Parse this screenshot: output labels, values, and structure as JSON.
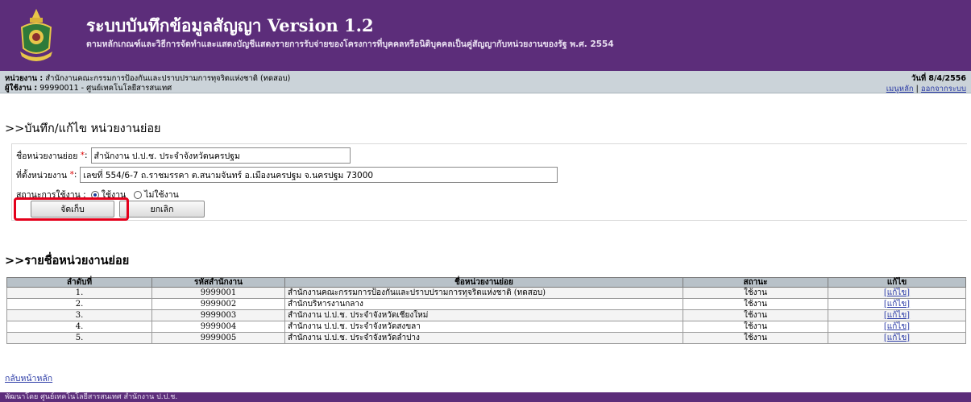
{
  "header": {
    "title": "ระบบบันทึกข้อมูลสัญญา Version 1.2",
    "subtitle": "ตามหลักเกณฑ์และวิธีการจัดทำและแสดงบัญชีแสดงรายการรับจ่ายของโครงการที่บุคคลหรือนิติบุคคลเป็นคู่สัญญากับหน่วยงานของรัฐ พ.ศ. 2554",
    "logo_icon": "emblem-icon",
    "bg_color": "#5c2d7a"
  },
  "info": {
    "agency_label": "หน่วยงาน :",
    "agency_value": "สำนักงานคณะกรรมการป้องกันและปราบปรามการทุจริตแห่งชาติ (ทดสอบ)",
    "user_label": "ผู้ใช้งาน :",
    "user_value": "99990011 - ศูนย์เทคโนโลยีสารสนเทศ",
    "date": "วันที่ 8/4/2556",
    "home_link": "เมนูหลัก",
    "separator": "|",
    "logout_link": "ออกจากระบบ"
  },
  "form": {
    "section_title": ">>บันทึก/แก้ไข หน่วยงานย่อย",
    "name_label": "ชื่อหน่วยงานย่อย",
    "required_mark": "*",
    "colon": ":",
    "name_value": "สำนักงาน ป.ป.ช. ประจำจังหวัดนครปฐม",
    "location_label": "ที่ตั้งหน่วยงาน",
    "location_value": "เลขที่ 554/6-7 ถ.ราชมรรคา ต.สนามจันทร์ อ.เมืองนครปฐม จ.นครปฐม 73000",
    "status_label": "สถานะการใช้งาน :",
    "status_options": [
      "ใช้งาน",
      "ไม่ใช้งาน"
    ],
    "status_selected": "ใช้งาน",
    "save_label": "จัดเก็บ",
    "cancel_label": "ยกเลิก",
    "highlight_color": "#e4001b"
  },
  "list": {
    "section_title": ">>รายชื่อหน่วยงานย่อย",
    "columns": [
      "ลำดับที่",
      "รหัสสำนักงาน",
      "ชื่อหน่วยงานย่อย",
      "สถานะ",
      "แก้ไข"
    ],
    "rows": [
      {
        "no": "1.",
        "code": "9999001",
        "name": "สำนักงานคณะกรรมการป้องกันและปราบปรามการทุจริตแห่งชาติ (ทดสอบ)",
        "status": "ใช้งาน",
        "edit": "[แก้ไข]"
      },
      {
        "no": "2.",
        "code": "9999002",
        "name": "สำนักบริหารงานกลาง",
        "status": "ใช้งาน",
        "edit": "[แก้ไข]"
      },
      {
        "no": "3.",
        "code": "9999003",
        "name": "สำนักงาน ป.ป.ช. ประจำจังหวัดเชียงใหม่",
        "status": "ใช้งาน",
        "edit": "[แก้ไข]"
      },
      {
        "no": "4.",
        "code": "9999004",
        "name": "สำนักงาน ป.ป.ช. ประจำจังหวัดสงขลา",
        "status": "ใช้งาน",
        "edit": "[แก้ไข]"
      },
      {
        "no": "5.",
        "code": "9999005",
        "name": "สำนักงาน ป.ป.ช. ประจำจังหวัดลำปาง",
        "status": "ใช้งาน",
        "edit": "[แก้ไข]"
      }
    ]
  },
  "back_link": "กลับหน้าหลัก",
  "footer": "พัฒนาโดย ศูนย์เทคโนโลยีสารสนเทศ สำนักงาน ป.ป.ช."
}
